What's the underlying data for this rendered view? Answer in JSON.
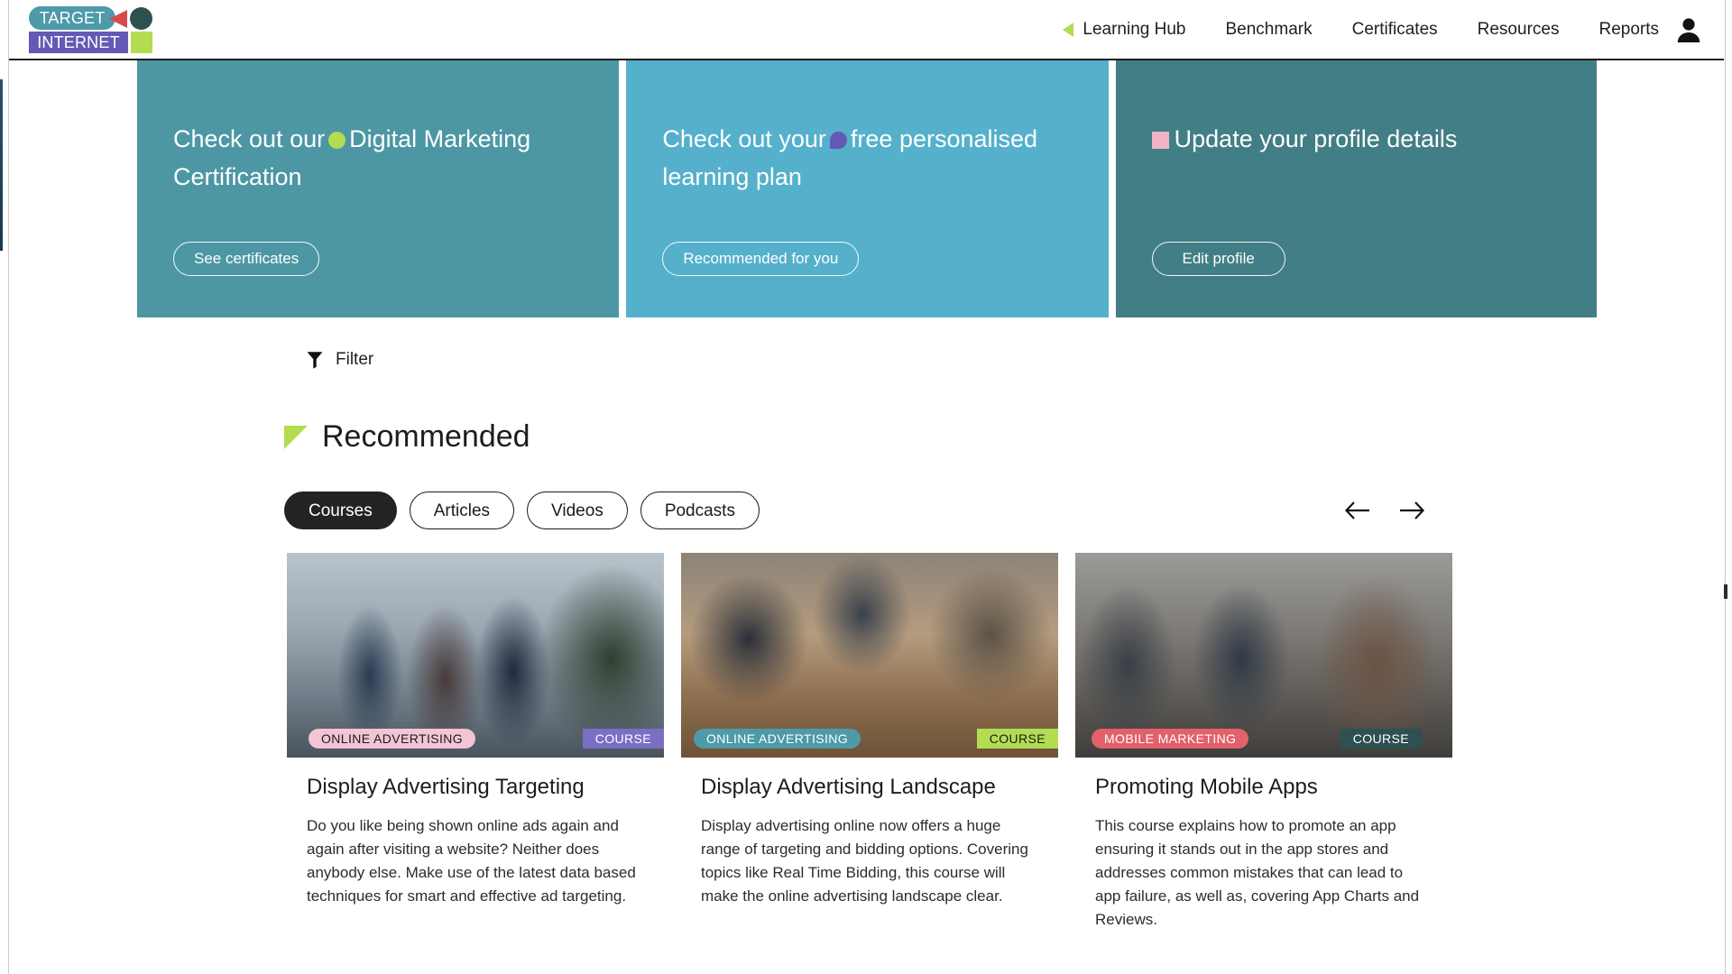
{
  "header": {
    "logo": {
      "top_word": "TARGET",
      "bottom_word": "INTERNET",
      "colors": {
        "target_pill": "#4d9aa8",
        "triangle": "#d9494e",
        "circle": "#2d5050",
        "internet_box": "#6459b5",
        "square": "#b3dc53"
      }
    },
    "nav_items": [
      {
        "label": "Learning Hub",
        "active": true,
        "marker_icon": "triangle-left-icon"
      },
      {
        "label": "Benchmark",
        "active": false
      },
      {
        "label": "Certificates",
        "active": false
      },
      {
        "label": "Resources",
        "active": false
      },
      {
        "label": "Reports",
        "active": false
      }
    ],
    "account_icon": "user-account-icon"
  },
  "banners": [
    {
      "title_before": "Check out our",
      "icon": "lime-circle-icon",
      "title_after": "Digital Marketing Certification",
      "button_label": "See certificates",
      "bg": "#4d97a4",
      "icon_color": "#b3dc53"
    },
    {
      "title_before": "Check out your",
      "icon": "purple-droplet-icon",
      "title_after": "free personalised learning plan",
      "button_label": "Recommended for you",
      "bg": "#55b0cc",
      "icon_color": "#6459b5"
    },
    {
      "title_before": "",
      "icon": "pink-square-icon",
      "title_after": "Update your profile details",
      "button_label": "Edit profile",
      "bg": "#417e85",
      "icon_color": "#f0b4c4"
    }
  ],
  "filter": {
    "label": "Filter",
    "icon": "funnel-icon"
  },
  "section": {
    "title": "Recommended",
    "marker_icon": "lime-triangle-icon"
  },
  "tabs": [
    {
      "label": "Courses",
      "active": true
    },
    {
      "label": "Articles",
      "active": false
    },
    {
      "label": "Videos",
      "active": false
    },
    {
      "label": "Podcasts",
      "active": false
    }
  ],
  "carousel": {
    "prev_icon": "arrow-left-icon",
    "next_icon": "arrow-right-icon"
  },
  "cards": [
    {
      "tag": "ONLINE ADVERTISING",
      "tag_bg": "#f2c4d4",
      "tag_fg": "#1c1c1c",
      "type": "COURSE",
      "type_bg": "#7a6fc4",
      "type_fg": "#ffffff",
      "title": "Display Advertising Targeting",
      "description": "Do you like being shown online ads again and again after visiting a website? Neither does anybody else. Make use of the latest data based techniques for smart and effective ad targeting.",
      "image": "photo-team-with-laptop-in-office"
    },
    {
      "tag": "ONLINE ADVERTISING",
      "tag_bg": "#4d9aa8",
      "tag_fg": "#ffffff",
      "type": "COURSE",
      "type_bg": "#b3dc53",
      "type_fg": "#1c1c1c",
      "title": "Display Advertising Landscape",
      "description": "Display advertising online now offers a huge range of targeting and bidding options. Covering topics like Real Time Bidding, this course will make the online advertising landscape clear.",
      "image": "photo-meeting-table-hands-writing"
    },
    {
      "tag": "MOBILE MARKETING",
      "tag_bg": "#e2616b",
      "tag_fg": "#ffffff",
      "type": "COURSE",
      "type_bg": "#2d5050",
      "type_fg": "#ffffff",
      "title": "Promoting Mobile Apps",
      "description": "This course explains how to promote an app ensuring it stands out in the app stores and addresses common mistakes that can lead to app failure, as well as, covering App Charts and Reviews.",
      "image": "photo-colleagues-discussing-at-laptop"
    }
  ]
}
